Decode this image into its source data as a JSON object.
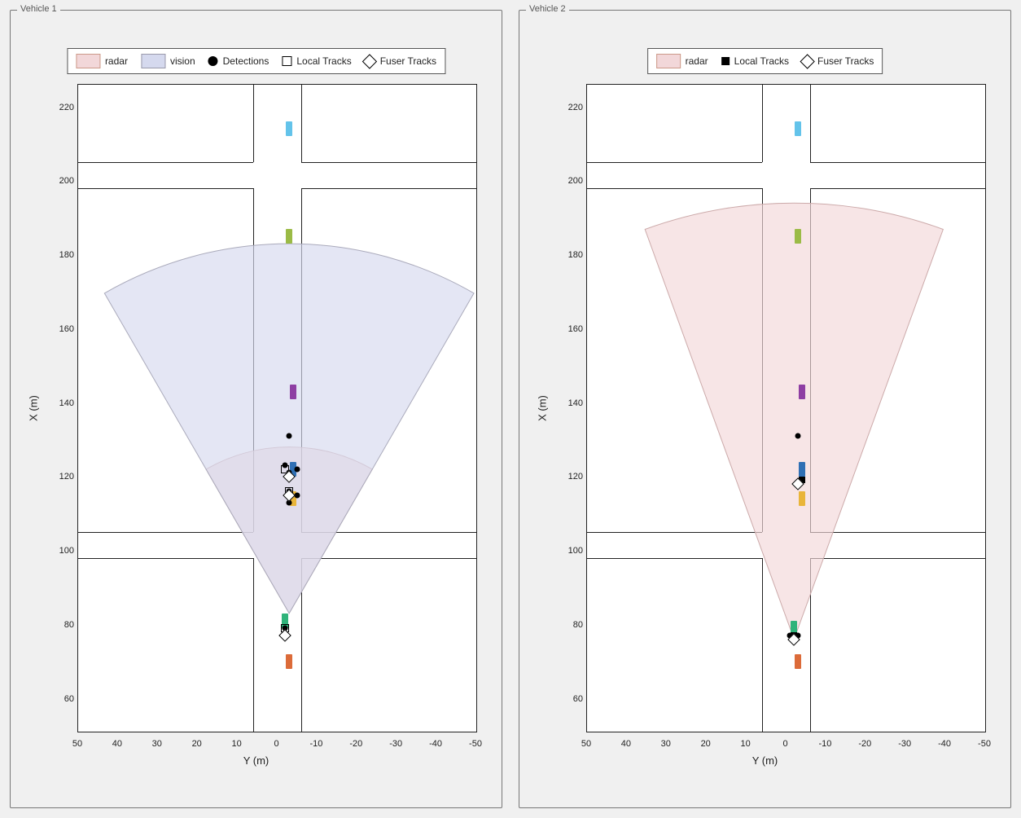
{
  "panels": [
    {
      "title": "Vehicle 1",
      "xlabel": "Y (m)",
      "ylabel": "X (m)"
    },
    {
      "title": "Vehicle 2",
      "xlabel": "Y (m)",
      "ylabel": "X (m)"
    }
  ],
  "legend1": {
    "radar": "radar",
    "vision": "vision",
    "detections": "Detections",
    "local": "Local Tracks",
    "fuser": "Fuser Tracks"
  },
  "legend2": {
    "radar": "radar",
    "local": "Local Tracks",
    "fuser": "Fuser Tracks"
  },
  "axes": {
    "xlim": [
      50,
      -50
    ],
    "ylim": [
      50,
      225
    ],
    "xticks": [
      50,
      40,
      30,
      20,
      10,
      0,
      -10,
      -20,
      -30,
      -40,
      -50
    ],
    "yticks": [
      60,
      80,
      100,
      120,
      140,
      160,
      180,
      200,
      220
    ]
  },
  "colors": {
    "radar_fill": "#f2d7d9",
    "radar_stroke": "#caa",
    "vision_fill": "#d5d9ee",
    "vision_stroke": "#aab",
    "sky": "#63c3ea",
    "olive": "#9bbb46",
    "purple": "#8e3ea3",
    "blue": "#2f6fb4",
    "yellow": "#e9b53a",
    "green": "#30b37a",
    "orange": "#dc6b39"
  },
  "chart_data": [
    {
      "type": "scatter",
      "title": "Vehicle 1",
      "xlabel": "Y (m)",
      "ylabel": "X (m)",
      "xlim": [
        50,
        -50
      ],
      "ylim": [
        50,
        225
      ],
      "road": {
        "h_x": [
          97,
          104,
          197,
          204
        ],
        "v_y": [
          6,
          -6
        ]
      },
      "fov": [
        {
          "name": "radar",
          "apex": [
            -3,
            82
          ],
          "range": 45,
          "half_deg": 30
        },
        {
          "name": "vision",
          "apex": [
            -3,
            82
          ],
          "range": 100,
          "half_deg": 30
        }
      ],
      "actors": [
        {
          "y": -3,
          "x": 213,
          "color": "sky"
        },
        {
          "y": -3,
          "x": 184,
          "color": "olive"
        },
        {
          "y": -4,
          "x": 142,
          "color": "purple"
        },
        {
          "y": -4,
          "x": 121,
          "color": "blue"
        },
        {
          "y": -4,
          "x": 113,
          "color": "yellow"
        },
        {
          "y": -2,
          "x": 80,
          "color": "green"
        },
        {
          "y": -3,
          "x": 69,
          "color": "orange"
        }
      ],
      "series": [
        {
          "name": "Detections",
          "marker": "dot",
          "points": [
            {
              "y": -3,
              "x": 130
            },
            {
              "y": -2,
              "x": 122
            },
            {
              "y": -5,
              "x": 121
            },
            {
              "y": -3,
              "x": 120
            },
            {
              "y": -3,
              "x": 115
            },
            {
              "y": -5,
              "x": 114
            },
            {
              "y": -3,
              "x": 112
            },
            {
              "y": -2,
              "x": 78
            }
          ]
        },
        {
          "name": "Local Tracks",
          "marker": "sq",
          "points": [
            {
              "y": -2,
              "x": 121
            },
            {
              "y": -3,
              "x": 115
            },
            {
              "y": -2,
              "x": 78
            }
          ]
        },
        {
          "name": "Fuser Tracks",
          "marker": "di",
          "points": [
            {
              "y": -3,
              "x": 119
            },
            {
              "y": -3,
              "x": 114
            },
            {
              "y": -2,
              "x": 76
            }
          ]
        }
      ]
    },
    {
      "type": "scatter",
      "title": "Vehicle 2",
      "xlabel": "Y (m)",
      "ylabel": "X (m)",
      "xlim": [
        50,
        -50
      ],
      "ylim": [
        50,
        225
      ],
      "road": {
        "h_x": [
          97,
          104,
          197,
          204
        ],
        "v_y": [
          6,
          -6
        ]
      },
      "fov": [
        {
          "name": "radar",
          "apex": [
            -2,
            75
          ],
          "range": 118,
          "half_deg": 20
        }
      ],
      "actors": [
        {
          "y": -3,
          "x": 213,
          "color": "sky"
        },
        {
          "y": -3,
          "x": 184,
          "color": "olive"
        },
        {
          "y": -4,
          "x": 142,
          "color": "purple"
        },
        {
          "y": -4,
          "x": 121,
          "color": "blue"
        },
        {
          "y": -4,
          "x": 113,
          "color": "yellow"
        },
        {
          "y": -2,
          "x": 78,
          "color": "green"
        },
        {
          "y": -3,
          "x": 69,
          "color": "orange"
        }
      ],
      "series": [
        {
          "name": "Detections",
          "marker": "dot",
          "points": [
            {
              "y": -3,
              "x": 130
            },
            {
              "y": -1,
              "x": 76
            },
            {
              "y": -3,
              "x": 76
            }
          ]
        },
        {
          "name": "Local Tracks",
          "marker": "fsq",
          "points": [
            {
              "y": -4,
              "x": 118
            },
            {
              "y": -2,
              "x": 76
            }
          ]
        },
        {
          "name": "Fuser Tracks",
          "marker": "di",
          "points": [
            {
              "y": -3,
              "x": 117
            },
            {
              "y": -2,
              "x": 75
            }
          ]
        }
      ]
    }
  ]
}
